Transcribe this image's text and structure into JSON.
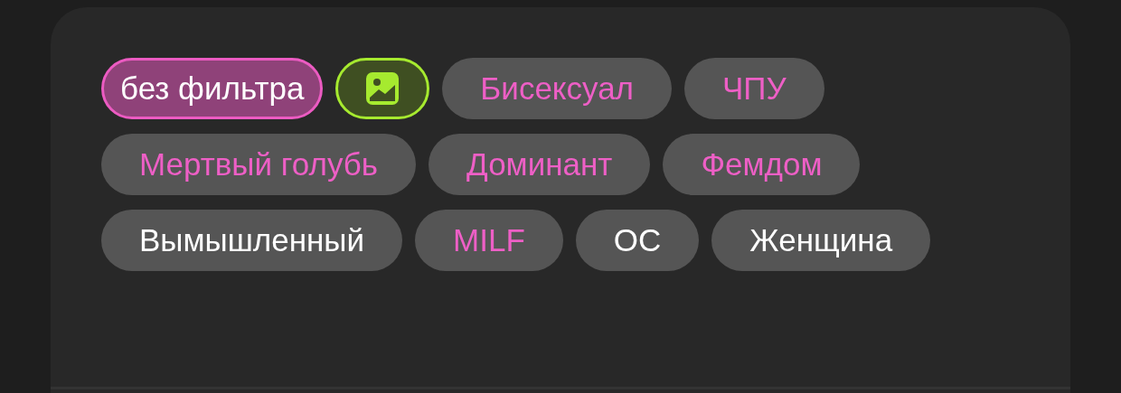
{
  "filters": [
    {
      "kind": "filter",
      "label": "без фильтра",
      "selected": true
    },
    {
      "kind": "image",
      "selected": true
    },
    {
      "kind": "tag",
      "label": "Бисексуал",
      "highlighted": true
    },
    {
      "kind": "tag",
      "label": "ЧПУ",
      "highlighted": true
    },
    {
      "kind": "tag",
      "label": "Мертвый голубь",
      "highlighted": true
    },
    {
      "kind": "tag",
      "label": "Доминант",
      "highlighted": true
    },
    {
      "kind": "tag",
      "label": "Фемдом",
      "highlighted": true
    },
    {
      "kind": "tag",
      "label": "Вымышленный",
      "highlighted": false
    },
    {
      "kind": "tag",
      "label": "MILF",
      "highlighted": true
    },
    {
      "kind": "tag",
      "label": "ОС",
      "highlighted": false
    },
    {
      "kind": "tag",
      "label": "Женщина",
      "highlighted": false
    }
  ]
}
